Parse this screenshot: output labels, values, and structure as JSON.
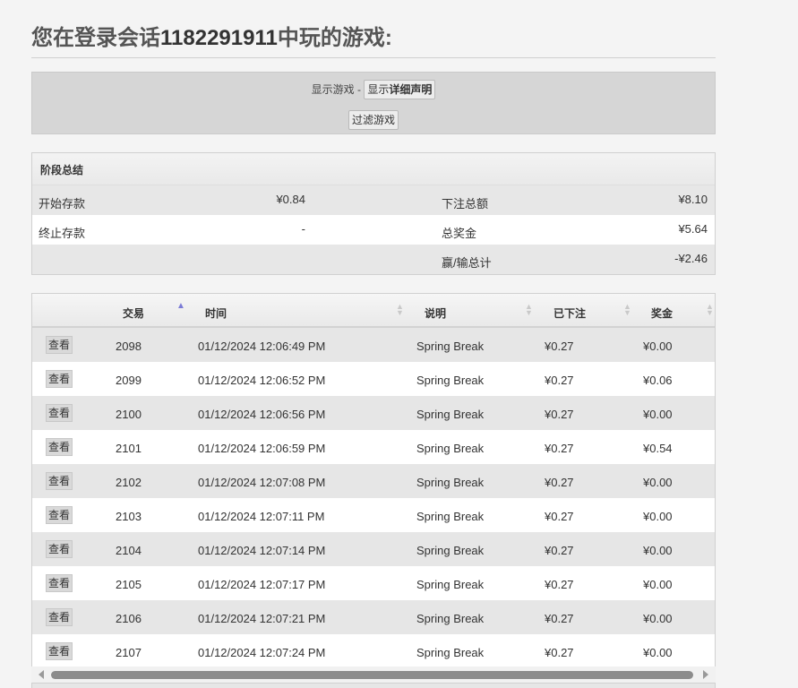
{
  "header": {
    "title_prefix": "您在登录会话",
    "session_id": "1182291911",
    "title_suffix": "中玩的游戏:"
  },
  "filter": {
    "show_games_label": "显示游戏 -",
    "show_details_prefix": "显示",
    "show_details_bold": "详细声明",
    "filter_button": "过滤游戏"
  },
  "summary": {
    "title": "阶段总结",
    "rows": [
      {
        "label1": "开始存款",
        "value1": "¥0.84",
        "label2": "下注总额",
        "value2": "¥8.10"
      },
      {
        "label1": "终止存款",
        "value1": "-",
        "label2": "总奖金",
        "value2": "¥5.64"
      },
      {
        "label1": "",
        "value1": "",
        "label2": "赢/输总计",
        "value2": "-¥2.46"
      }
    ]
  },
  "table": {
    "columns": {
      "transaction": "交易",
      "time": "时间",
      "description": "说明",
      "bet": "已下注",
      "win": "奖金"
    },
    "view_label": "查看",
    "rows": [
      {
        "id": "2098",
        "time": "01/12/2024 12:06:49 PM",
        "desc": "Spring Break",
        "bet": "¥0.27",
        "win": "¥0.00"
      },
      {
        "id": "2099",
        "time": "01/12/2024 12:06:52 PM",
        "desc": "Spring Break",
        "bet": "¥0.27",
        "win": "¥0.06"
      },
      {
        "id": "2100",
        "time": "01/12/2024 12:06:56 PM",
        "desc": "Spring Break",
        "bet": "¥0.27",
        "win": "¥0.00"
      },
      {
        "id": "2101",
        "time": "01/12/2024 12:06:59 PM",
        "desc": "Spring Break",
        "bet": "¥0.27",
        "win": "¥0.54"
      },
      {
        "id": "2102",
        "time": "01/12/2024 12:07:08 PM",
        "desc": "Spring Break",
        "bet": "¥0.27",
        "win": "¥0.00"
      },
      {
        "id": "2103",
        "time": "01/12/2024 12:07:11 PM",
        "desc": "Spring Break",
        "bet": "¥0.27",
        "win": "¥0.00"
      },
      {
        "id": "2104",
        "time": "01/12/2024 12:07:14 PM",
        "desc": "Spring Break",
        "bet": "¥0.27",
        "win": "¥0.00"
      },
      {
        "id": "2105",
        "time": "01/12/2024 12:07:17 PM",
        "desc": "Spring Break",
        "bet": "¥0.27",
        "win": "¥0.00"
      },
      {
        "id": "2106",
        "time": "01/12/2024 12:07:21 PM",
        "desc": "Spring Break",
        "bet": "¥0.27",
        "win": "¥0.00"
      },
      {
        "id": "2107",
        "time": "01/12/2024 12:07:24 PM",
        "desc": "Spring Break",
        "bet": "¥0.27",
        "win": "¥0.00"
      }
    ]
  }
}
